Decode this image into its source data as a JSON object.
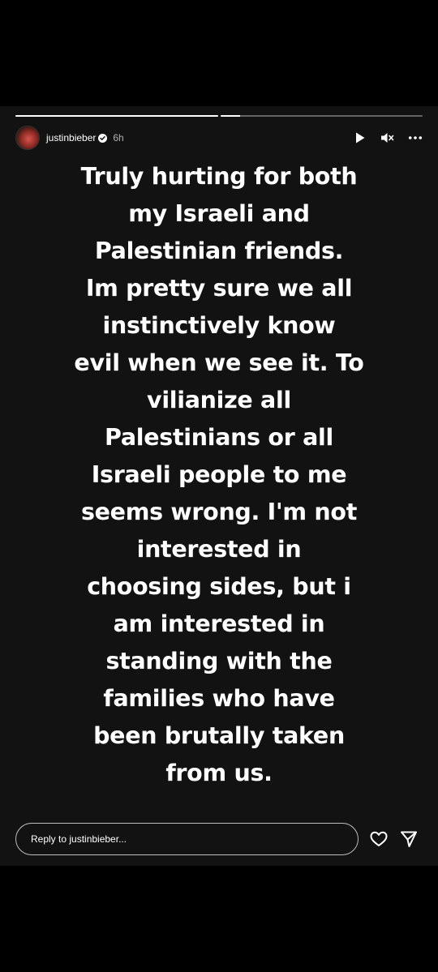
{
  "story": {
    "progress": [
      1.0,
      0.1
    ],
    "header": {
      "avatar": "avatar-image",
      "username": "justinbieber",
      "verified_icon": "verified-badge-icon",
      "time": "6h",
      "controls": [
        "play-icon",
        "mute-icon",
        "more-icon"
      ]
    },
    "text_lines": [
      "Truly hurting for both",
      "my Israeli and",
      "Palestinian friends.",
      "Im pretty sure we all",
      "instinctively know",
      "evil when we see it. To",
      "vilianize all",
      "Palestinians or all",
      "Israeli people to me",
      "seems wrong. I'm not",
      "interested in",
      "choosing sides, but i",
      "am interested in",
      "standing with the",
      "families who have",
      "been brutally taken",
      "from us."
    ],
    "footer": {
      "reply_placeholder": "Reply to justinbieber...",
      "icons": [
        "heart-icon",
        "send-icon"
      ]
    }
  },
  "colors": {
    "background": "#000000",
    "story_background": "#121212",
    "text": "#ffffff"
  }
}
